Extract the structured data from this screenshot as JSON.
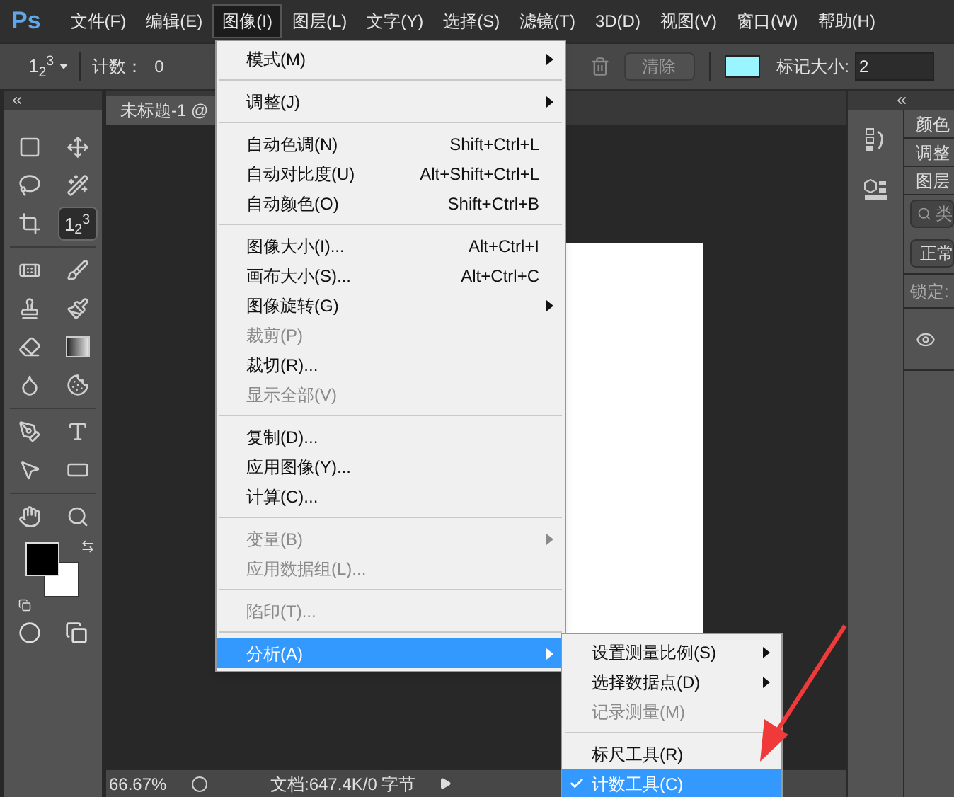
{
  "app": {
    "logo": "Ps"
  },
  "menubar": [
    {
      "label": "文件(F)",
      "selected": false
    },
    {
      "label": "编辑(E)",
      "selected": false
    },
    {
      "label": "图像(I)",
      "selected": true
    },
    {
      "label": "图层(L)",
      "selected": false
    },
    {
      "label": "文字(Y)",
      "selected": false
    },
    {
      "label": "选择(S)",
      "selected": false
    },
    {
      "label": "滤镜(T)",
      "selected": false
    },
    {
      "label": "3D(D)",
      "selected": false
    },
    {
      "label": "视图(V)",
      "selected": false
    },
    {
      "label": "窗口(W)",
      "selected": false
    },
    {
      "label": "帮助(H)",
      "selected": false
    }
  ],
  "options_bar": {
    "tool_preset": "1$_{2}$$^{3}$",
    "count_label": "计数：",
    "count_value": "0",
    "clear_button": "清除",
    "marker_size_label": "标记大小:",
    "marker_size": "2"
  },
  "toolbar": [
    {
      "kind": "marquee",
      "selected": false
    },
    {
      "kind": "move",
      "selected": false
    },
    {
      "kind": "lasso",
      "selected": false
    },
    {
      "kind": "wand",
      "selected": false
    },
    {
      "kind": "crop",
      "selected": false
    },
    {
      "kind": "count",
      "label": "1$_{2}$$^{3}$",
      "selected": true
    },
    {
      "kind": "heal",
      "selected": false
    },
    {
      "kind": "brush",
      "selected": false
    },
    {
      "kind": "stamp",
      "selected": false
    },
    {
      "kind": "history",
      "selected": false
    },
    {
      "kind": "eraser",
      "selected": false
    },
    {
      "kind": "gradient",
      "selected": false
    },
    {
      "kind": "blur",
      "selected": false
    },
    {
      "kind": "sponge",
      "selected": false
    },
    {
      "kind": "pen",
      "selected": false
    },
    {
      "kind": "type",
      "selected": false
    },
    {
      "kind": "select",
      "selected": false
    },
    {
      "kind": "shape",
      "selected": false
    },
    {
      "kind": "hand",
      "selected": false
    },
    {
      "kind": "zoom",
      "selected": false
    }
  ],
  "document": {
    "tab": "未标题-1 @"
  },
  "status_bar": {
    "zoom": "66.67%",
    "info": "文档:647.4K/0 字节"
  },
  "panels": {
    "tabs": [
      "颜色",
      "调整",
      "图层"
    ],
    "search_placeholder": "类",
    "blend_mode": "正常",
    "lock_label": "锁定:"
  },
  "image_menu": [
    {
      "kind": "item",
      "label": "模式(M)",
      "submenu": true,
      "disabled": false,
      "selected": false
    },
    {
      "kind": "separator"
    },
    {
      "kind": "item",
      "label": "调整(J)",
      "submenu": true,
      "disabled": false,
      "selected": false
    },
    {
      "kind": "separator"
    },
    {
      "kind": "item",
      "label": "自动色调(N)",
      "shortcut": "Shift+Ctrl+L",
      "submenu": false,
      "disabled": false,
      "selected": false
    },
    {
      "kind": "item",
      "label": "自动对比度(U)",
      "shortcut": "Alt+Shift+Ctrl+L",
      "submenu": false,
      "disabled": false,
      "selected": false
    },
    {
      "kind": "item",
      "label": "自动颜色(O)",
      "shortcut": "Shift+Ctrl+B",
      "submenu": false,
      "disabled": false,
      "selected": false
    },
    {
      "kind": "separator"
    },
    {
      "kind": "item",
      "label": "图像大小(I)...",
      "shortcut": "Alt+Ctrl+I",
      "submenu": false,
      "disabled": false,
      "selected": false
    },
    {
      "kind": "item",
      "label": "画布大小(S)...",
      "shortcut": "Alt+Ctrl+C",
      "submenu": false,
      "disabled": false,
      "selected": false
    },
    {
      "kind": "item",
      "label": "图像旋转(G)",
      "submenu": true,
      "disabled": false,
      "selected": false
    },
    {
      "kind": "item",
      "label": "裁剪(P)",
      "submenu": false,
      "disabled": true,
      "selected": false
    },
    {
      "kind": "item",
      "label": "裁切(R)...",
      "submenu": false,
      "disabled": false,
      "selected": false
    },
    {
      "kind": "item",
      "label": "显示全部(V)",
      "submenu": false,
      "disabled": true,
      "selected": false
    },
    {
      "kind": "separator"
    },
    {
      "kind": "item",
      "label": "复制(D)...",
      "submenu": false,
      "disabled": false,
      "selected": false
    },
    {
      "kind": "item",
      "label": "应用图像(Y)...",
      "submenu": false,
      "disabled": false,
      "selected": false
    },
    {
      "kind": "item",
      "label": "计算(C)...",
      "submenu": false,
      "disabled": false,
      "selected": false
    },
    {
      "kind": "separator"
    },
    {
      "kind": "item",
      "label": "变量(B)",
      "submenu": true,
      "disabled": true,
      "selected": false
    },
    {
      "kind": "item",
      "label": "应用数据组(L)...",
      "submenu": false,
      "disabled": true,
      "selected": false
    },
    {
      "kind": "separator"
    },
    {
      "kind": "item",
      "label": "陷印(T)...",
      "submenu": false,
      "disabled": true,
      "selected": false
    },
    {
      "kind": "separator"
    },
    {
      "kind": "item",
      "label": "分析(A)",
      "submenu": true,
      "disabled": false,
      "selected": true
    }
  ],
  "analysis_submenu": [
    {
      "kind": "item",
      "label": "设置测量比例(S)",
      "submenu": true,
      "disabled": false,
      "checked": false,
      "selected": false
    },
    {
      "kind": "item",
      "label": "选择数据点(D)",
      "submenu": true,
      "disabled": false,
      "checked": false,
      "selected": false
    },
    {
      "kind": "item",
      "label": "记录测量(M)",
      "submenu": false,
      "disabled": true,
      "checked": false,
      "selected": false
    },
    {
      "kind": "separator"
    },
    {
      "kind": "item",
      "label": "标尺工具(R)",
      "submenu": false,
      "disabled": false,
      "checked": false,
      "selected": false
    },
    {
      "kind": "item",
      "label": "计数工具(C)",
      "submenu": false,
      "disabled": false,
      "checked": true,
      "selected": true
    }
  ]
}
